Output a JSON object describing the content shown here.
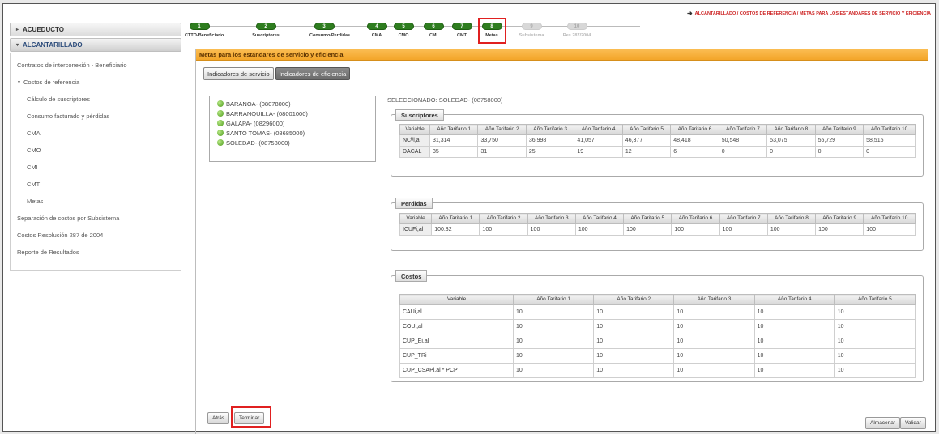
{
  "breadcrumb": "ALCANTARILLADO / COSTOS DE REFERENCIA / METAS PARA LOS ESTÁNDARES DE SERVICIO Y EFICIENCIA",
  "sidebar": {
    "acueducto": "ACUEDUCTO",
    "alcantarillado": "ALCANTARILLADO",
    "items": [
      {
        "label": "Contratos de interconexión - Beneficiario"
      },
      {
        "label": "Costos de referencia"
      },
      {
        "label": "Cálculo de suscriptores"
      },
      {
        "label": "Consumo facturado y pérdidas"
      },
      {
        "label": "CMA"
      },
      {
        "label": "CMO"
      },
      {
        "label": "CMI"
      },
      {
        "label": "CMT"
      },
      {
        "label": "Metas"
      },
      {
        "label": "Separación de costos por Subsistema"
      },
      {
        "label": "Costos Resolución 287 de 2004"
      },
      {
        "label": "Reporte de Resultados"
      }
    ]
  },
  "stepper": [
    {
      "num": "1",
      "label": "CTTO-Beneficiario"
    },
    {
      "num": "2",
      "label": "Suscriptores"
    },
    {
      "num": "3",
      "label": "Consumo/Perdidas"
    },
    {
      "num": "4",
      "label": "CMA"
    },
    {
      "num": "5",
      "label": "CMO"
    },
    {
      "num": "6",
      "label": "CMI"
    },
    {
      "num": "7",
      "label": "CMT"
    },
    {
      "num": "8",
      "label": "Metas"
    },
    {
      "num": "9",
      "label": "Subsistema"
    },
    {
      "num": "10",
      "label": "Res 287/2004"
    }
  ],
  "panel": {
    "title": "Metas para los estándares de servicio y eficiencia",
    "tab_servicio": "Indicadores de servicio",
    "tab_eficiencia": "Indicadores de eficiencia",
    "selected": "SELECCIONADO: SOLEDAD- (08758000)"
  },
  "municipios": [
    "BARANOA- (08078000)",
    "BARRANQUILLA- (08001000)",
    "GALAPA- (08296000)",
    "SANTO TOMAS- (08685000)",
    "SOLEDAD- (08758000)"
  ],
  "suscriptores": {
    "legend": "Suscriptores",
    "headers": [
      "Variable",
      "Año Tarifario 1",
      "Año Tarifario 2",
      "Año Tarifario 3",
      "Año Tarifario 4",
      "Año Tarifario 5",
      "Año Tarifario 6",
      "Año Tarifario 7",
      "Año Tarifario 8",
      "Año Tarifario 9",
      "Año Tarifario 10"
    ],
    "rows": [
      {
        "var": "NCᴿi,al",
        "values": [
          "31,314",
          "33,750",
          "36,998",
          "41,057",
          "46,377",
          "48,418",
          "50,548",
          "53,075",
          "55,729",
          "58,515"
        ]
      },
      {
        "var": "DACAL",
        "values": [
          "35",
          "31",
          "25",
          "19",
          "12",
          "6",
          "0",
          "0",
          "0",
          "0"
        ]
      }
    ]
  },
  "perdidas": {
    "legend": "Perdidas",
    "headers": [
      "Variable",
      "Año Tarifario 1",
      "Año Tarifario 2",
      "Año Tarifario 3",
      "Año Tarifario 4",
      "Año Tarifario 5",
      "Año Tarifario 6",
      "Año Tarifario 7",
      "Año Tarifario 8",
      "Año Tarifario 9",
      "Año Tarifario 10"
    ],
    "rows": [
      {
        "var": "ICUFi,al",
        "values": [
          "100.32",
          "100",
          "100",
          "100",
          "100",
          "100",
          "100",
          "100",
          "100",
          "100"
        ]
      }
    ]
  },
  "costos": {
    "legend": "Costos",
    "headers": [
      "Variable",
      "Año Tarifario 1",
      "Año Tarifario 2",
      "Año Tarifario 3",
      "Año Tarifario 4",
      "Año Tarifario 5"
    ],
    "rows": [
      {
        "var": "CAUi,al",
        "values": [
          "10",
          "10",
          "10",
          "10",
          "10"
        ]
      },
      {
        "var": "COUi,al",
        "values": [
          "10",
          "10",
          "10",
          "10",
          "10"
        ]
      },
      {
        "var": "CUP_Ei,al",
        "values": [
          "10",
          "10",
          "10",
          "10",
          "10"
        ]
      },
      {
        "var": "CUP_TRi",
        "values": [
          "10",
          "10",
          "10",
          "10",
          "10"
        ]
      },
      {
        "var": "CUP_CSAPi,al * PCP",
        "values": [
          "10",
          "10",
          "10",
          "10",
          "10"
        ]
      }
    ]
  },
  "buttons": {
    "atras": "Atrás",
    "terminar": "Terminar",
    "almacenar": "Almacenar",
    "validar": "Validar"
  }
}
